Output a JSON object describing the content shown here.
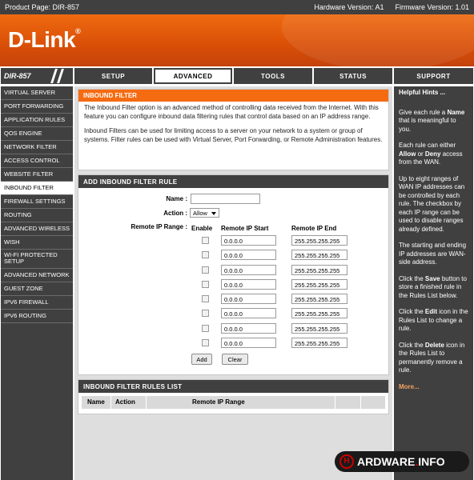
{
  "topbar": {
    "product": "Product Page: DIR-857",
    "hardware": "Hardware Version: A1",
    "firmware": "Firmware Version: 1.01"
  },
  "brand": {
    "logo": "D-Link",
    "reg": "®",
    "color": "#e35c0b"
  },
  "nav": {
    "model": "DIR-857",
    "tabs": [
      "SETUP",
      "ADVANCED",
      "TOOLS",
      "STATUS",
      "SUPPORT"
    ],
    "active_tab": "ADVANCED"
  },
  "sidebar": {
    "items": [
      "VIRTUAL SERVER",
      "PORT FORWARDING",
      "APPLICATION RULES",
      "QOS ENGINE",
      "NETWORK FILTER",
      "ACCESS CONTROL",
      "WEBSITE FILTER",
      "INBOUND FILTER",
      "FIREWALL SETTINGS",
      "ROUTING",
      "ADVANCED WIRELESS",
      "WISH",
      "WI-FI PROTECTED SETUP",
      "ADVANCED NETWORK",
      "GUEST ZONE",
      "IPV6 FIREWALL",
      "IPV6 ROUTING"
    ],
    "active": "INBOUND FILTER"
  },
  "intro": {
    "title": "INBOUND FILTER",
    "p1": "The Inbound Filter option is an advanced method of controlling data received from the Internet. With this feature you can configure inbound data filtering rules that control data based on an IP address range.",
    "p2": "Inbound Filters can be used for limiting access to a server on your network to a system or group of systems. Filter rules can be used with Virtual Server, Port Forwarding, or Remote Administration features."
  },
  "add_rule": {
    "title": "ADD INBOUND FILTER RULE",
    "name_label": "Name :",
    "name_value": "",
    "action_label": "Action :",
    "action_value": "Allow",
    "range_label": "Remote IP Range :",
    "col_enable": "Enable",
    "col_start": "Remote IP Start",
    "col_end": "Remote IP End",
    "rows": [
      {
        "enabled": false,
        "start": "0.0.0.0",
        "end": "255.255.255.255"
      },
      {
        "enabled": false,
        "start": "0.0.0.0",
        "end": "255.255.255.255"
      },
      {
        "enabled": false,
        "start": "0.0.0.0",
        "end": "255.255.255.255"
      },
      {
        "enabled": false,
        "start": "0.0.0.0",
        "end": "255.255.255.255"
      },
      {
        "enabled": false,
        "start": "0.0.0.0",
        "end": "255.255.255.255"
      },
      {
        "enabled": false,
        "start": "0.0.0.0",
        "end": "255.255.255.255"
      },
      {
        "enabled": false,
        "start": "0.0.0.0",
        "end": "255.255.255.255"
      },
      {
        "enabled": false,
        "start": "0.0.0.0",
        "end": "255.255.255.255"
      }
    ],
    "add_label": "Add",
    "clear_label": "Clear"
  },
  "rules_list": {
    "title": "INBOUND FILTER RULES LIST",
    "col_name": "Name",
    "col_action": "Action",
    "col_range": "Remote IP Range"
  },
  "hints": {
    "title": "Helpful Hints ...",
    "h1a": "Give each rule a ",
    "h1b": "Name",
    "h1c": " that is meaningful to you.",
    "h2a": "Each rule can either ",
    "h2b": "Allow",
    "h2c": " or ",
    "h2d": "Deny",
    "h2e": " access from the WAN.",
    "h3": "Up to eight ranges of WAN IP addresses can be controlled by each rule. The checkbox by each IP range can be used to disable ranges already defined.",
    "h4": "The starting and ending IP addresses are WAN-side address.",
    "h5a": "Click the ",
    "h5b": "Save",
    "h5c": " button to store a finished rule in the Rules List below.",
    "h6a": "Click the ",
    "h6b": "Edit",
    "h6c": " icon in the Rules List to change a rule.",
    "h7a": "Click the ",
    "h7b": "Delete",
    "h7c": " icon in the Rules List to permanently remove a rule.",
    "more": "More..."
  },
  "watermark": {
    "text": "ARDWARE",
    "dot": ".",
    "suffix": "INFO"
  }
}
